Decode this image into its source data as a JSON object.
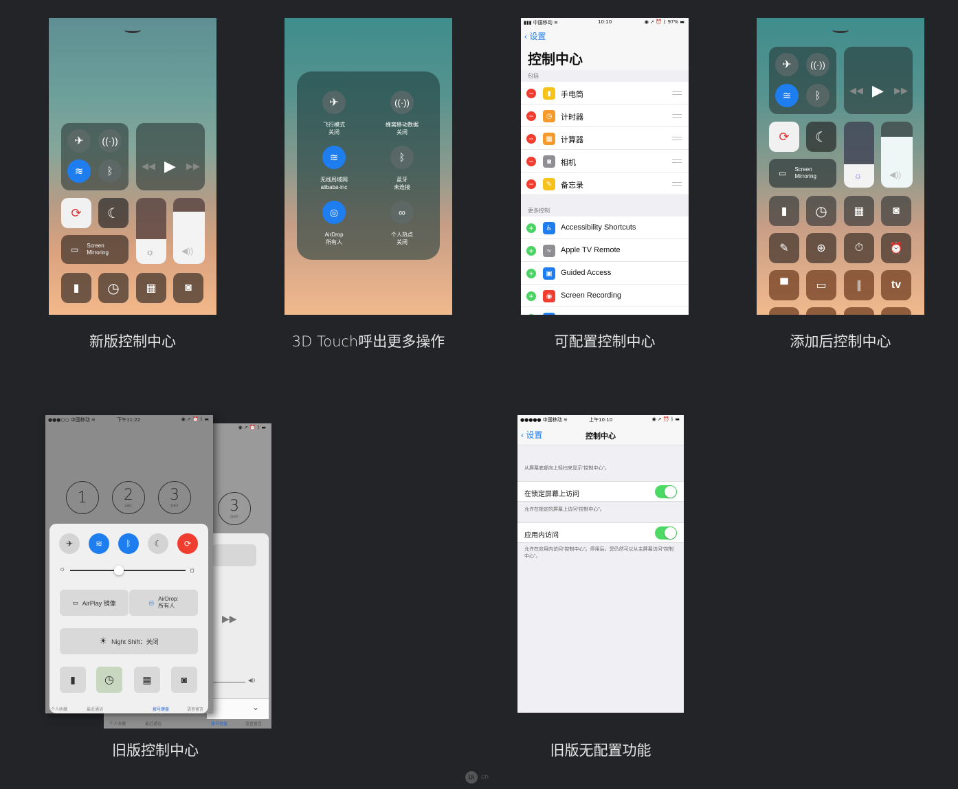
{
  "captions": {
    "c1": "新版控制中心",
    "c2": "3D Touch呼出更多操作",
    "c3": "可配置控制中心",
    "c4": "添加后控制中心",
    "c5": "旧版控制中心",
    "c6": "旧版无配置功能"
  },
  "new_cc": {
    "mirroring": "Screen\nMirroring"
  },
  "touch3d": {
    "airplane": "飞行模式",
    "airplane_state": "关闭",
    "cellular": "蜂窝移动数据",
    "cellular_state": "关闭",
    "wifi": "无线局域网",
    "wifi_state": "alibaba-inc",
    "bluetooth": "蓝牙",
    "bluetooth_state": "未连接",
    "airdrop": "AirDrop",
    "airdrop_state": "所有人",
    "hotspot": "个人热点",
    "hotspot_state": "关闭"
  },
  "config": {
    "carrier": "中国移动",
    "time": "10:10",
    "battery": "97%",
    "back": "设置",
    "title": "控制中心",
    "include_header": "包括",
    "included": [
      "手电筒",
      "计时器",
      "计算器",
      "相机",
      "备忘录"
    ],
    "more_header": "更多控制",
    "more": [
      "Accessibility Shortcuts",
      "Apple TV Remote",
      "Guided Access",
      "Screen Recording"
    ]
  },
  "added_cc": {
    "mirroring": "Screen\nMirroring",
    "tv": "tv"
  },
  "old_cc": {
    "carrier": "中国移动",
    "time": "下午11:22",
    "keys": [
      {
        "n": "1",
        "s": ""
      },
      {
        "n": "2",
        "s": "ABC"
      },
      {
        "n": "3",
        "s": "DEF"
      }
    ],
    "back_key": {
      "n": "3",
      "s": "DEF"
    },
    "airplay": "AirPlay 镜像",
    "airdrop": "AirDrop:\n所有人",
    "nightshift": "Night Shift：关闭",
    "tabs": [
      "个人收藏",
      "最近通话",
      "拨号键盘",
      "语音留言"
    ]
  },
  "old_settings": {
    "carrier": "中国移动",
    "time": "上午10:10",
    "back": "设置",
    "title": "控制中心",
    "desc1": "从屏幕底部向上轻扫来显示“控制中心”。",
    "lock_label": "在锁定屏幕上访问",
    "lock_desc": "允许在锁定的屏幕上访问“控制中心”。",
    "app_label": "应用内访问",
    "app_desc": "允许在应用内访问“控制中心”。停用后，您仍然可以从主屏幕访问“控制中心”。"
  },
  "watermark": {
    "logo": "Ui",
    "suffix": "·cn"
  },
  "colors": {
    "bg": "#232428",
    "ios_blue": "#1e7ef0",
    "green": "#4cd964",
    "red": "#f13c30"
  }
}
